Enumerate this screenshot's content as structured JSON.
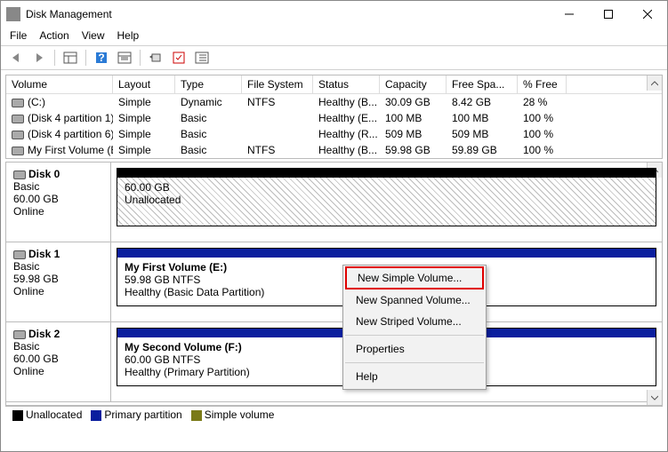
{
  "window": {
    "title": "Disk Management"
  },
  "menubar": [
    "File",
    "Action",
    "View",
    "Help"
  ],
  "table": {
    "headers": {
      "volume": "Volume",
      "layout": "Layout",
      "type": "Type",
      "fs": "File System",
      "status": "Status",
      "capacity": "Capacity",
      "free": "Free Spa...",
      "pfree": "% Free"
    },
    "rows": [
      {
        "volume": "(C:)",
        "layout": "Simple",
        "type": "Dynamic",
        "fs": "NTFS",
        "status": "Healthy (B...",
        "capacity": "30.09 GB",
        "free": "8.42 GB",
        "pfree": "28 %"
      },
      {
        "volume": "(Disk 4 partition 1)",
        "layout": "Simple",
        "type": "Basic",
        "fs": "",
        "status": "Healthy (E...",
        "capacity": "100 MB",
        "free": "100 MB",
        "pfree": "100 %"
      },
      {
        "volume": "(Disk 4 partition 6)",
        "layout": "Simple",
        "type": "Basic",
        "fs": "",
        "status": "Healthy (R...",
        "capacity": "509 MB",
        "free": "509 MB",
        "pfree": "100 %"
      },
      {
        "volume": "My First Volume (E:)",
        "layout": "Simple",
        "type": "Basic",
        "fs": "NTFS",
        "status": "Healthy (B...",
        "capacity": "59.98 GB",
        "free": "59.89 GB",
        "pfree": "100 %"
      }
    ]
  },
  "disks": [
    {
      "name": "Disk 0",
      "type": "Basic",
      "size": "60.00 GB",
      "state": "Online",
      "part": {
        "title": "",
        "line2": "60.00 GB",
        "line3": "Unallocated",
        "bar": "#000",
        "hatch": true
      }
    },
    {
      "name": "Disk 1",
      "type": "Basic",
      "size": "59.98 GB",
      "state": "Online",
      "part": {
        "title": "My First Volume  (E:)",
        "line2": "59.98 GB NTFS",
        "line3": "Healthy (Basic Data Partition)",
        "bar": "#0a1e9e",
        "hatch": false
      }
    },
    {
      "name": "Disk 2",
      "type": "Basic",
      "size": "60.00 GB",
      "state": "Online",
      "part": {
        "title": "My Second Volume  (F:)",
        "line2": "60.00 GB NTFS",
        "line3": "Healthy (Primary Partition)",
        "bar": "#0a1e9e",
        "hatch": false
      }
    }
  ],
  "context_menu": {
    "items": [
      "New Simple Volume...",
      "New Spanned Volume...",
      "New Striped Volume...",
      "Properties",
      "Help"
    ]
  },
  "legend": {
    "unallocated": "Unallocated",
    "primary": "Primary partition",
    "simple": "Simple volume"
  },
  "colors": {
    "unallocated": "#000000",
    "primary": "#0a1e9e",
    "simple": "#7a7a18"
  }
}
